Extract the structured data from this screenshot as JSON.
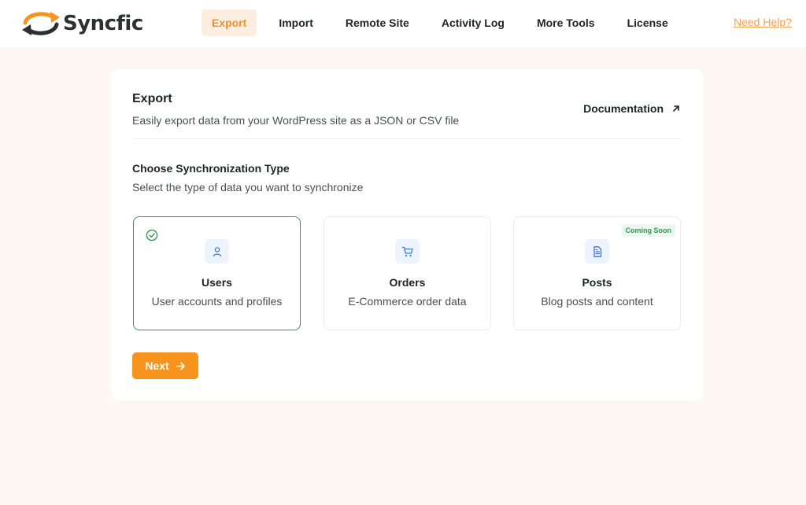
{
  "brand": {
    "name": "Syncfic",
    "accent": "#f7941d"
  },
  "nav": {
    "items": [
      {
        "label": "Export",
        "active": true
      },
      {
        "label": "Import",
        "active": false
      },
      {
        "label": "Remote Site",
        "active": false
      },
      {
        "label": "Activity Log",
        "active": false
      },
      {
        "label": "More Tools",
        "active": false
      },
      {
        "label": "License",
        "active": false
      }
    ],
    "help_label": "Need Help?"
  },
  "card": {
    "title": "Export",
    "subtitle": "Easily export data from your WordPress site as a JSON or CSV file",
    "doc_label": "Documentation",
    "section_title": "Choose Synchronization Type",
    "section_subtitle": "Select the type of data you want to synchronize",
    "options": [
      {
        "title": "Users",
        "description": "User accounts and profiles",
        "icon": "user-icon",
        "selected": true
      },
      {
        "title": "Orders",
        "description": "E-Commerce order data",
        "icon": "cart-icon",
        "selected": false
      },
      {
        "title": "Posts",
        "description": "Blog posts and content",
        "icon": "document-icon",
        "selected": false,
        "badge": "Coming Soon"
      }
    ],
    "next_label": "Next"
  }
}
